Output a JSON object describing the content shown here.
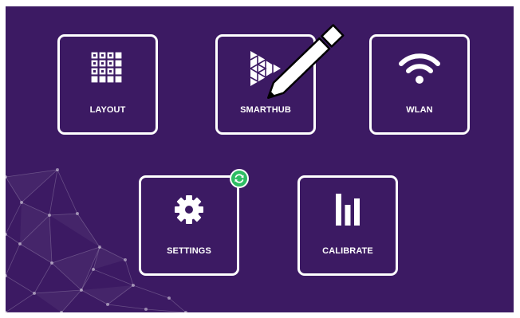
{
  "colors": {
    "background": "#3c1a63",
    "tile_border": "#ffffff",
    "badge": "#2ebd63"
  },
  "tiles": [
    {
      "id": "layout",
      "label": "LAYOUT",
      "icon": "grid-icon"
    },
    {
      "id": "smarthub",
      "label": "SMARTHUB",
      "icon": "play-triangle-icon"
    },
    {
      "id": "wlan",
      "label": "WLAN",
      "icon": "wifi-icon"
    },
    {
      "id": "settings",
      "label": "SETTINGS",
      "icon": "gear-icon",
      "badge_icon": "refresh-icon"
    },
    {
      "id": "calibrate",
      "label": "CALIBRATE",
      "icon": "bars-icon"
    }
  ],
  "cursor": "pen-cursor-icon"
}
